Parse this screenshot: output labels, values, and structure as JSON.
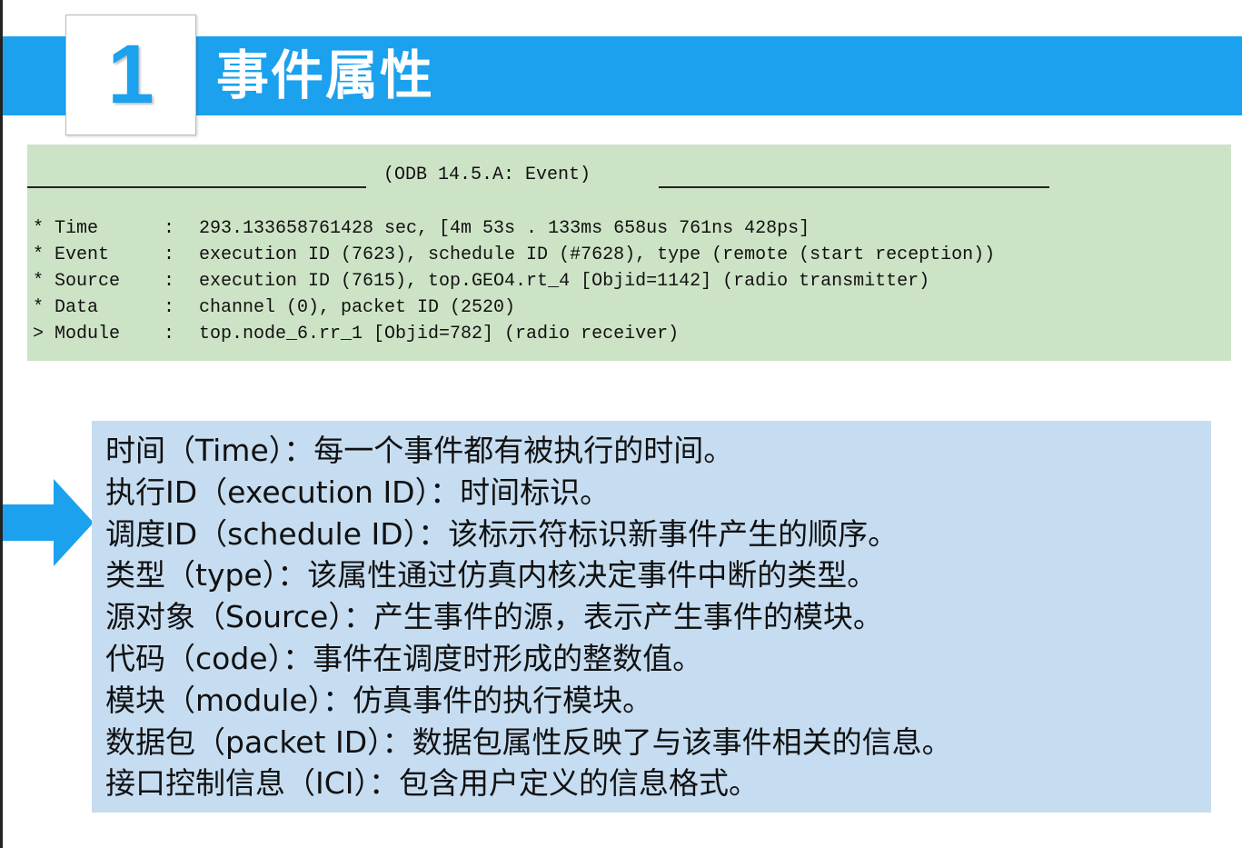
{
  "slide": {
    "number": "1",
    "title": "事件属性"
  },
  "odb": {
    "header": "(ODB 14.5.A: Event)",
    "rows": [
      {
        "marker": "*",
        "label": "Time",
        "value": "293.133658761428 sec, [4m 53s . 133ms 658us 761ns 428ps]"
      },
      {
        "marker": "*",
        "label": "Event",
        "value": "execution ID (7623), schedule ID (#7628), type (remote (start reception))"
      },
      {
        "marker": "*",
        "label": "Source",
        "value": "execution ID (7615), top.GEO4.rt_4 [Objid=1142] (radio transmitter)"
      },
      {
        "marker": "*",
        "label": "Data",
        "value": "channel (0), packet ID (2520)"
      },
      {
        "marker": ">",
        "label": "Module",
        "value": "top.node_6.rr_1 [Objid=782] (radio receiver)"
      }
    ]
  },
  "descriptions": [
    "时间（Time）：每一个事件都有被执行的时间。",
    "执行ID（execution ID）：时间标识。",
    "调度ID（schedule ID）：该标示符标识新事件产生的顺序。",
    "类型（type）：该属性通过仿真内核决定事件中断的类型。",
    "源对象（Source）：产生事件的源，表示产生事件的模块。",
    "代码（code）：事件在调度时形成的整数值。",
    "模块（module）：仿真事件的执行模块。",
    "数据包（packet ID）：数据包属性反映了与该事件相关的信息。",
    "接口控制信息（ICI）：包含用户定义的信息格式。"
  ],
  "colors": {
    "accent": "#1ba1ee",
    "code_bg": "#cde3c6",
    "desc_bg": "#c6ddf1"
  },
  "icons": {
    "pointer": "right-arrow-icon"
  }
}
